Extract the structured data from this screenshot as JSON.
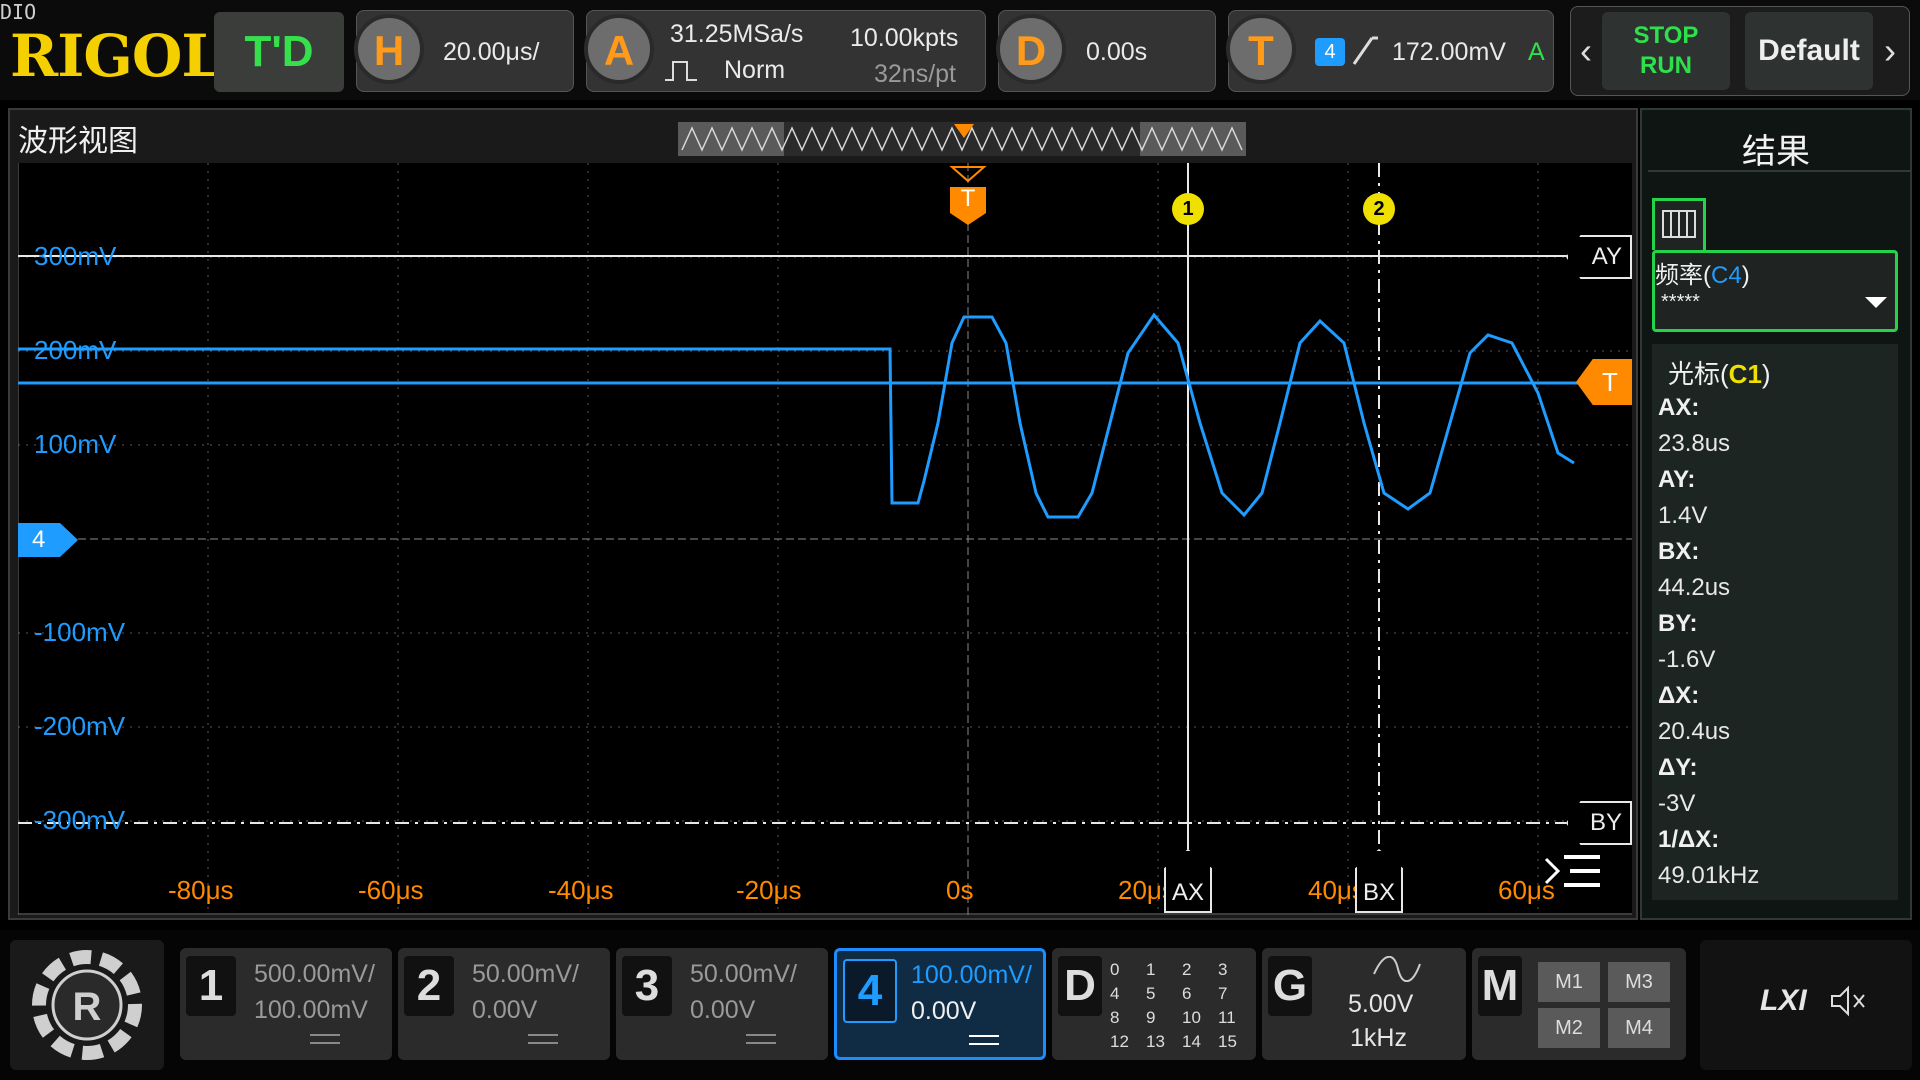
{
  "top": {
    "corner_tag": "DIO",
    "logo": "RIGOL",
    "td_label": "T'D",
    "horizontal": {
      "letter": "H",
      "value": "20.00μs/"
    },
    "acquire": {
      "letter": "A",
      "sample_rate": "31.25MSa/s",
      "mode": "Norm",
      "points": "10.00kpts",
      "per_point": "32ns/pt"
    },
    "delay": {
      "letter": "D",
      "value": "0.00s"
    },
    "trigger": {
      "letter": "T",
      "source": "4",
      "level": "172.00mV",
      "mode": "A"
    },
    "stop_label": "STOP",
    "run_label": "RUN",
    "default_label": "Default"
  },
  "wave": {
    "title": "波形视图",
    "y_labels": [
      "300mV",
      "200mV",
      "100mV",
      "-100mV",
      "-200mV",
      "-300mV"
    ],
    "x_labels": [
      "-80μs",
      "-60μs",
      "-40μs",
      "-20μs",
      "0s",
      "20μs",
      "40μs",
      "60μs"
    ],
    "markers": {
      "trigger": "T",
      "cursor1": "1",
      "cursor2": "2",
      "ay": "AY",
      "by": "BY",
      "ax": "AX",
      "bx": "BX",
      "level": "T",
      "ch4": "4"
    },
    "channel_color": "#1f9cff",
    "trigger_color": "#ff8a00"
  },
  "results": {
    "title": "结果",
    "freq_label": "频率(",
    "freq_source": "C4",
    "freq_close": ")",
    "freq_value": "*****",
    "cursor_label": "光标(",
    "cursor_source": "C1",
    "cursor_close": ")",
    "items": [
      {
        "label": "AX:",
        "value": "23.8us"
      },
      {
        "label": "AY:",
        "value": "1.4V"
      },
      {
        "label": "BX:",
        "value": "44.2us"
      },
      {
        "label": "BY:",
        "value": "-1.6V"
      },
      {
        "label": "ΔX:",
        "value": "20.4us"
      },
      {
        "label": "ΔY:",
        "value": "-3V"
      },
      {
        "label": "1/ΔX:",
        "value": "49.01kHz"
      }
    ]
  },
  "bottom": {
    "ch1": {
      "num": "1",
      "scale": "500.00mV/",
      "offset": "100.00mV"
    },
    "ch2": {
      "num": "2",
      "scale": "50.00mV/",
      "offset": "0.00V"
    },
    "ch3": {
      "num": "3",
      "scale": "50.00mV/",
      "offset": "0.00V"
    },
    "ch4": {
      "num": "4",
      "scale": "100.00mV/",
      "offset": "0.00V"
    },
    "digital": {
      "letter": "D",
      "bits": [
        "0",
        "1",
        "2",
        "3",
        "4",
        "5",
        "6",
        "7",
        "8",
        "9",
        "10",
        "11",
        "12",
        "13",
        "14",
        "15"
      ]
    },
    "generator": {
      "letter": "G",
      "amplitude": "5.00V",
      "freq": "1kHz"
    },
    "math": {
      "letter": "M",
      "m1": "M1",
      "m2": "M2",
      "m3": "M3",
      "m4": "M4"
    },
    "lxi": "LXI"
  }
}
